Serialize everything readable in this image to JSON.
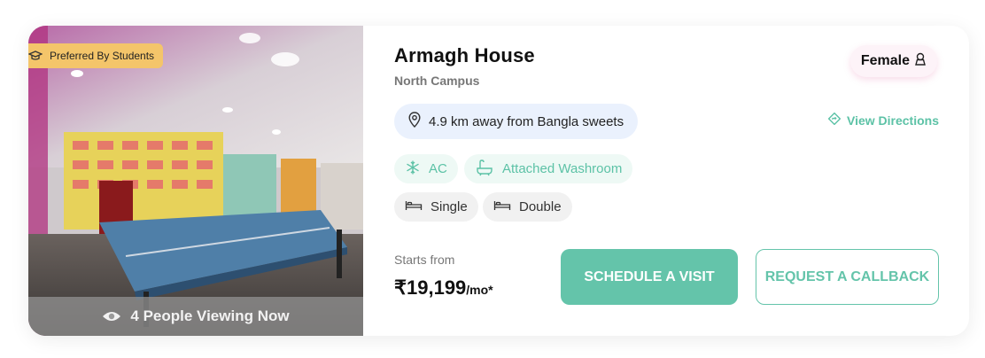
{
  "listing": {
    "badge": "Preferred By Students",
    "viewing_text": "4 People Viewing Now",
    "title": "Armagh House",
    "location": "North Campus",
    "gender": "Female",
    "distance": "4.9 km away from Bangla sweets",
    "directions_label": "View Directions",
    "amenities": [
      "AC",
      "Attached Washroom"
    ],
    "room_types": [
      "Single",
      "Double"
    ],
    "price_caption": "Starts from",
    "price": "₹19,199",
    "price_unit": "/mo*",
    "schedule_label": "SCHEDULE A VISIT",
    "callback_label": "REQUEST A CALLBACK"
  },
  "colors": {
    "accent": "#64c4aa",
    "badge": "#f4c56a",
    "distance_bg": "#eaf1fd",
    "gender_bg": "#fdf3f8"
  },
  "icons": [
    "graduation-cap-icon",
    "eye-icon",
    "female-icon",
    "location-pin-icon",
    "directions-icon",
    "snowflake-icon",
    "washroom-icon",
    "bed-icon"
  ]
}
